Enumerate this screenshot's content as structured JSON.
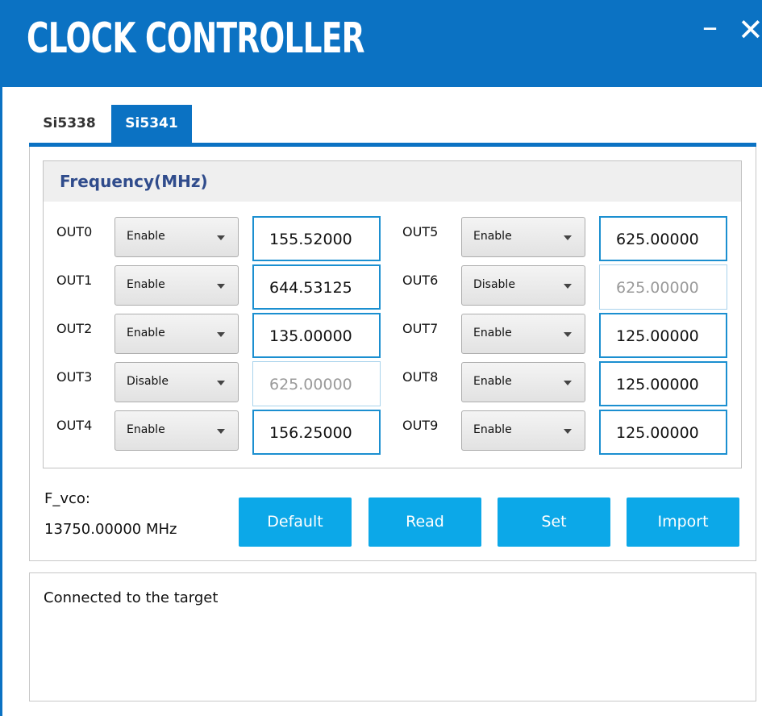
{
  "window": {
    "title": "CLOCK CONTROLLER",
    "minimize_glyph": "–",
    "close_glyph": "✕",
    "accent_color": "#0b72c3"
  },
  "tabs": [
    {
      "label": "Si5338",
      "active": false
    },
    {
      "label": "Si5341",
      "active": true
    }
  ],
  "frequency": {
    "title": "Frequency(MHz)",
    "outputs": [
      {
        "label": "OUT0",
        "state": "Enable",
        "value": "155.52000",
        "enabled": true
      },
      {
        "label": "OUT1",
        "state": "Enable",
        "value": "644.53125",
        "enabled": true
      },
      {
        "label": "OUT2",
        "state": "Enable",
        "value": "135.00000",
        "enabled": true
      },
      {
        "label": "OUT3",
        "state": "Disable",
        "value": "625.00000",
        "enabled": false
      },
      {
        "label": "OUT4",
        "state": "Enable",
        "value": "156.25000",
        "enabled": true
      },
      {
        "label": "OUT5",
        "state": "Enable",
        "value": "625.00000",
        "enabled": true
      },
      {
        "label": "OUT6",
        "state": "Disable",
        "value": "625.00000",
        "enabled": false
      },
      {
        "label": "OUT7",
        "state": "Enable",
        "value": "125.00000",
        "enabled": true
      },
      {
        "label": "OUT8",
        "state": "Enable",
        "value": "125.00000",
        "enabled": true
      },
      {
        "label": "OUT9",
        "state": "Enable",
        "value": "125.00000",
        "enabled": true
      }
    ]
  },
  "vco": {
    "label": "F_vco:",
    "value": "13750.00000 MHz"
  },
  "buttons": {
    "default_label": "Default",
    "read_label": "Read",
    "set_label": "Set",
    "import_label": "Import",
    "color": "#0ca8e8"
  },
  "log": {
    "text": "Connected to the target"
  }
}
